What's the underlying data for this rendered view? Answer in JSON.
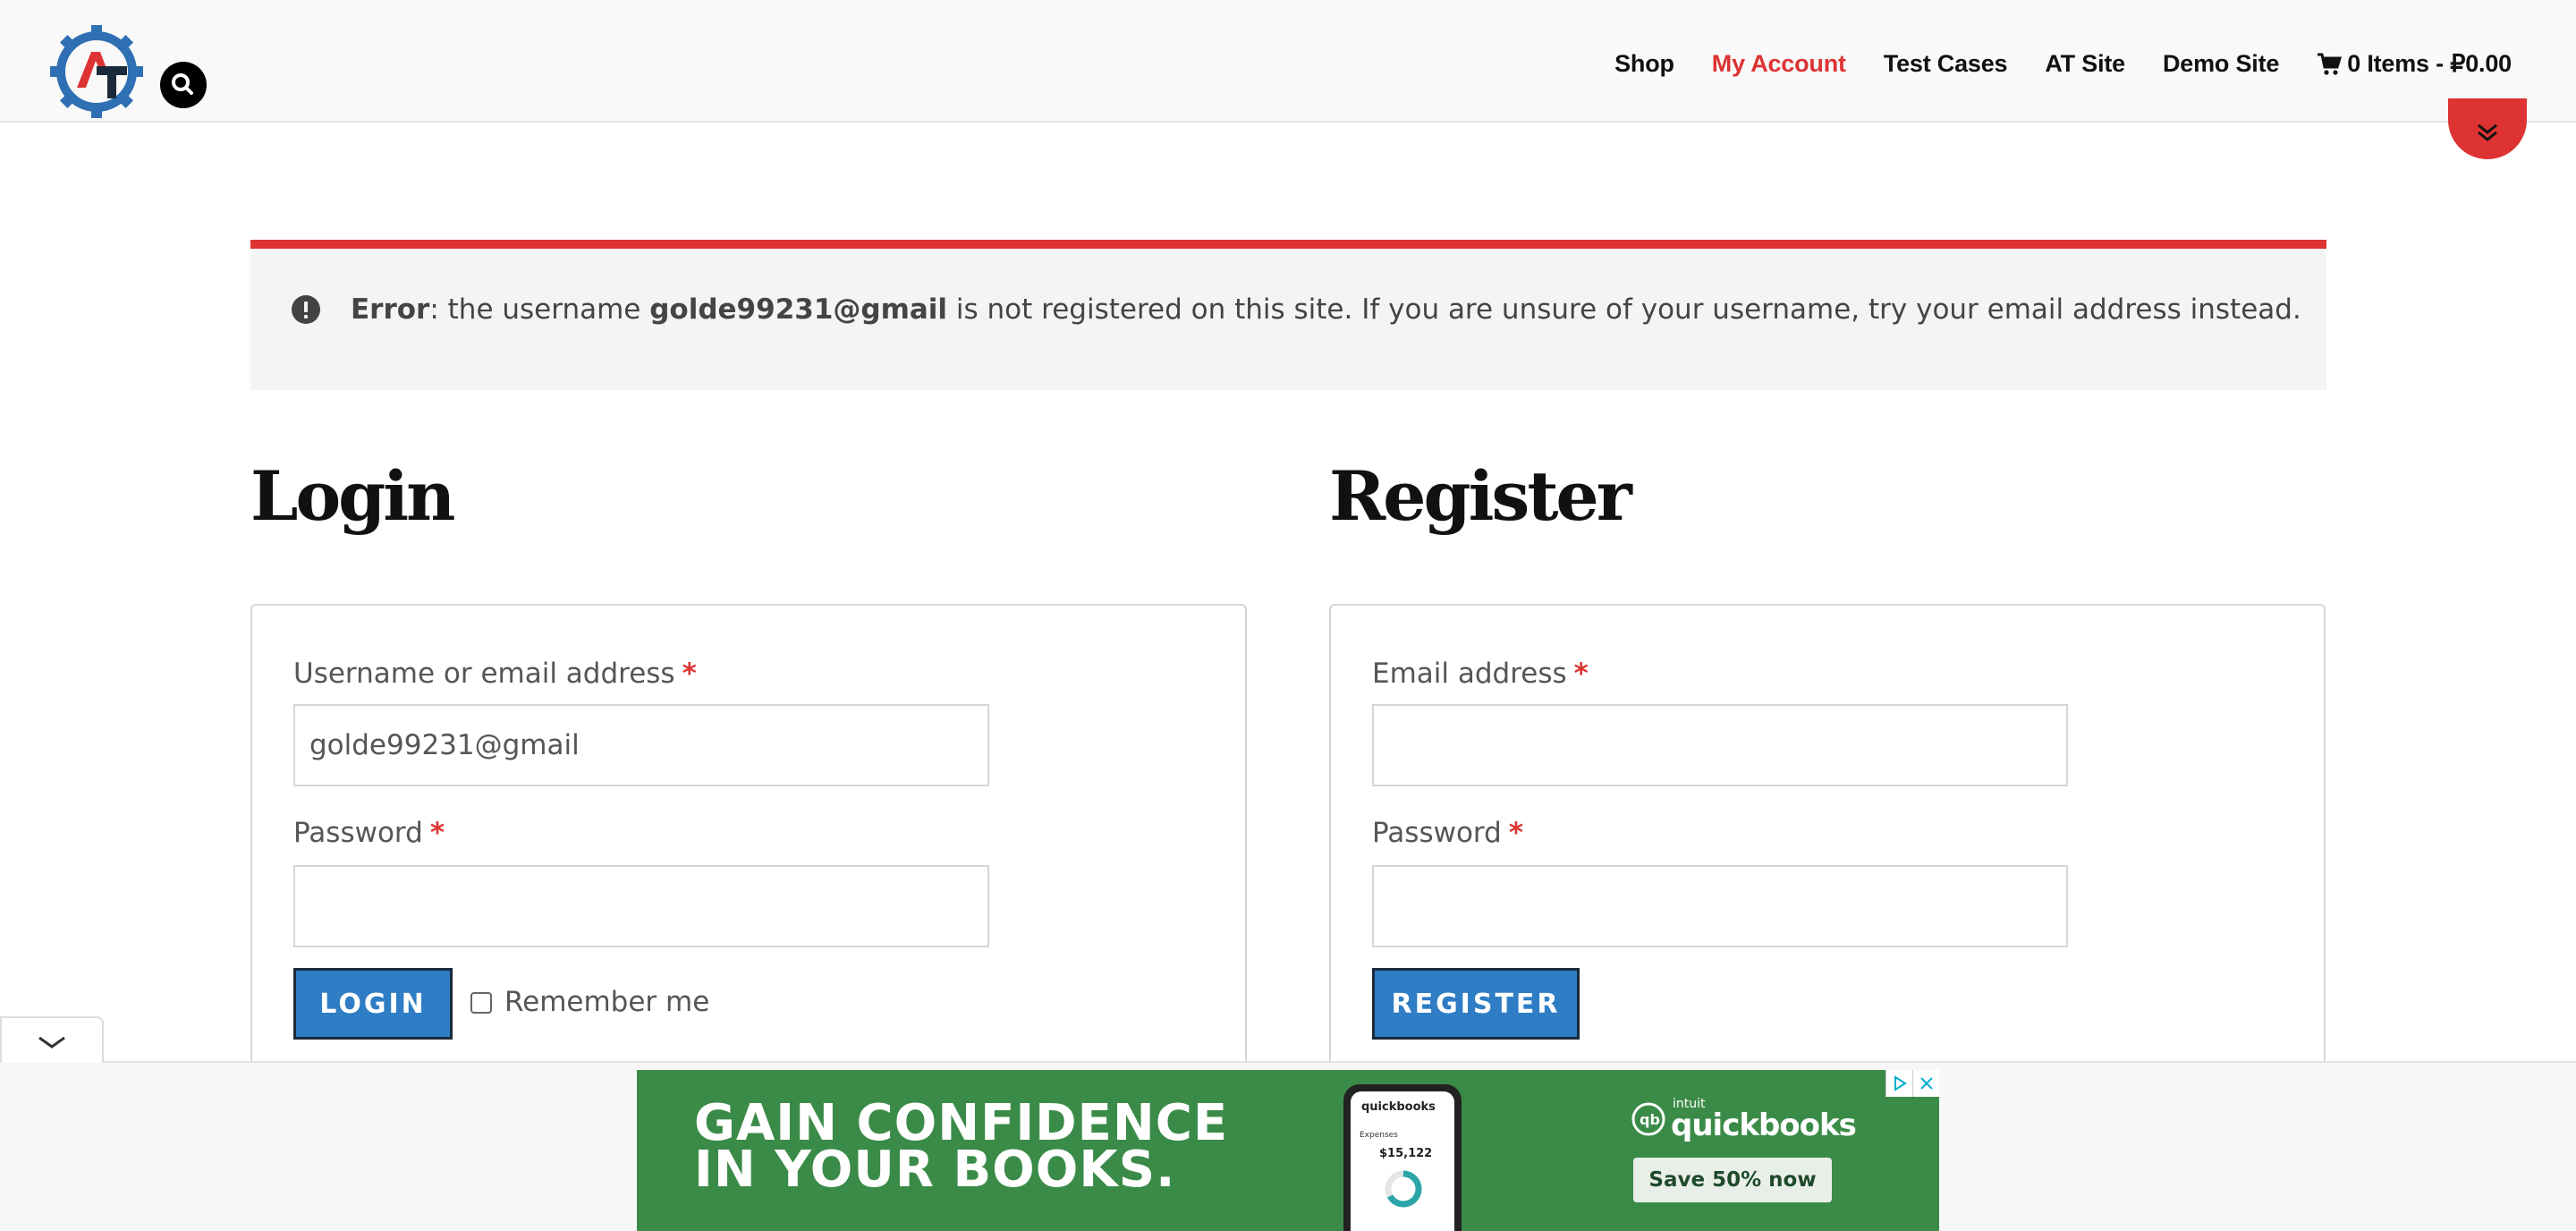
{
  "header": {
    "logo_letters": "AT",
    "nav": [
      {
        "label": "Shop",
        "active": false
      },
      {
        "label": "My Account",
        "active": true
      },
      {
        "label": "Test Cases",
        "active": false
      },
      {
        "label": "AT Site",
        "active": false
      },
      {
        "label": "Demo Site",
        "active": false
      }
    ],
    "cart_label": "0 Items - ₽0.00"
  },
  "notice": {
    "prefix": "Error",
    "text1": ": the username ",
    "username": "golde99231@gmail",
    "text2": " is not registered on this site. If you are unsure of your username, try your email address instead."
  },
  "login": {
    "heading": "Login",
    "username_label": "Username or email address",
    "username_value": "golde99231@gmail",
    "password_label": "Password",
    "required_mark": "*",
    "button": "LOGIN",
    "remember_label": "Remember me"
  },
  "register": {
    "heading": "Register",
    "email_label": "Email address",
    "password_label": "Password",
    "required_mark": "*",
    "button": "REGISTER"
  },
  "ad": {
    "headline_1": "GAIN CONFIDENCE",
    "headline_2": "IN YOUR BOOKS.",
    "brand_top": "intuit",
    "brand": "quickbooks",
    "cta": "Save 50% now",
    "phone_brand": "quickbooks",
    "phone_section": "Expenses",
    "phone_amount": "$15,122"
  },
  "colors": {
    "accent": "#dd3333",
    "button": "#2e7dc5",
    "ad_green": "#3b8b48"
  }
}
